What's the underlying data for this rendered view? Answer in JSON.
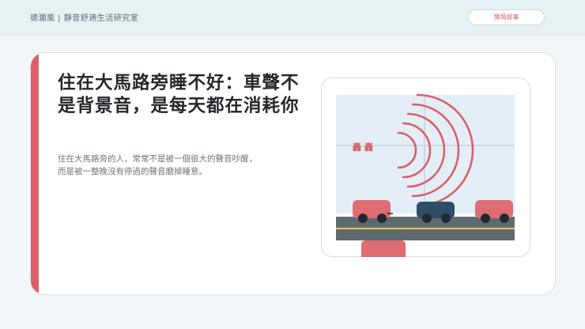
{
  "header": {
    "brand": "德瀾風 | 靜音舒適生活研究室",
    "action_label": "情境故事"
  },
  "main": {
    "headline": "住在大馬路旁睡不好：車聲不是背景音，是每天都在消耗你",
    "body_line_1": "住在大馬路旁的人，常常不是被一個很大的聲音吵醒，",
    "body_line_2": "而是被一整晚沒有停過的聲音磨掉睡意。"
  },
  "illustration": {
    "sound_label": "轟 轟",
    "colors": {
      "accent": "#d9606a",
      "sky": "#e4eef6",
      "road": "#5d6a70",
      "lane": "#e8c84a",
      "car_red": "#df6b73",
      "car_blue": "#2f4c68",
      "wheel": "#1f2a30"
    }
  }
}
